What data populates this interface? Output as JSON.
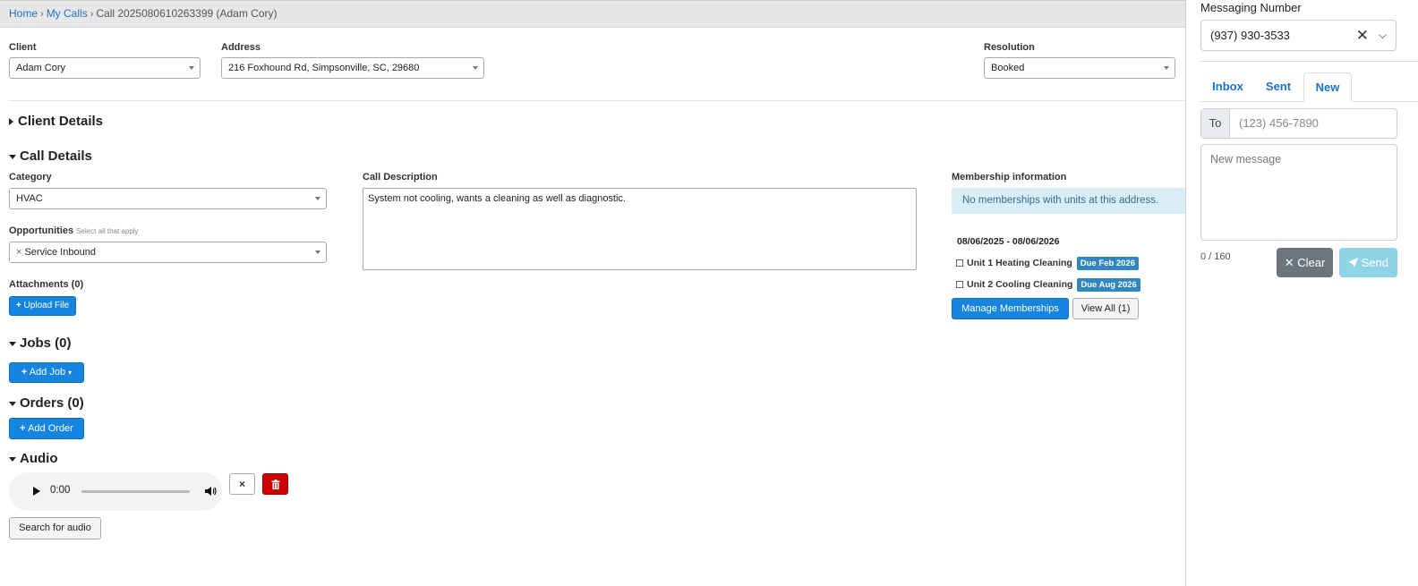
{
  "breadcrumb": {
    "home": "Home",
    "my_calls": "My Calls",
    "current": "Call 2025080610263399 (Adam Cory)",
    "separator": "›"
  },
  "header_fields": {
    "client_label": "Client",
    "client_value": "Adam Cory",
    "address_label": "Address",
    "address_value": "216 Foxhound Rd, Simpsonville, SC, 29680",
    "resolution_label": "Resolution",
    "resolution_value": "Booked"
  },
  "sections": {
    "client_details": "Client Details",
    "call_details": "Call Details",
    "jobs": "Jobs (0)",
    "orders": "Orders (0)",
    "audio": "Audio"
  },
  "call_details": {
    "category_label": "Category",
    "category_value": "HVAC",
    "opportunities_label": "Opportunities",
    "opportunities_hint": "Select all that apply",
    "opportunity_tag": "Service Inbound",
    "tag_remove": "×",
    "attachments_label": "Attachments (0)",
    "upload_button": "Upload File",
    "description_label": "Call Description",
    "description_value": "System not cooling, wants a cleaning as well as diagnostic."
  },
  "membership": {
    "label": "Membership information",
    "notice": "No memberships with units at this address.",
    "period": "08/06/2025 - 08/06/2026",
    "units": [
      {
        "name": "Unit 1 Heating Cleaning",
        "badge": "Due Feb 2026"
      },
      {
        "name": "Unit 2 Cooling Cleaning",
        "badge": "Due Aug 2026"
      }
    ],
    "manage_button": "Manage Memberships",
    "view_all_button": "View All (1)"
  },
  "jobs": {
    "add_button": "Add Job"
  },
  "orders": {
    "add_button": "Add Order"
  },
  "audio": {
    "time": "0:00",
    "close_icon": "×",
    "search_button": "Search for audio"
  },
  "messaging": {
    "title": "Messaging Number",
    "number": "(937) 930-3533",
    "clear_icon": "✕",
    "chevron": "⌵",
    "tabs": [
      "Inbox",
      "Sent",
      "New"
    ],
    "active_tab": "New",
    "to_label": "To",
    "to_placeholder": "(123) 456-7890",
    "message_placeholder": "New message",
    "counter": "0 / 160",
    "clear_button": "Clear",
    "send_button": "Send"
  },
  "colors": {
    "link": "#1a73c8",
    "primary": "#1585e0",
    "badge": "#2f86c0",
    "danger": "#cc0000",
    "info_bg": "#d9edf7",
    "send_disabled": "#8ed3e6",
    "clear_grey": "#6c757d"
  }
}
